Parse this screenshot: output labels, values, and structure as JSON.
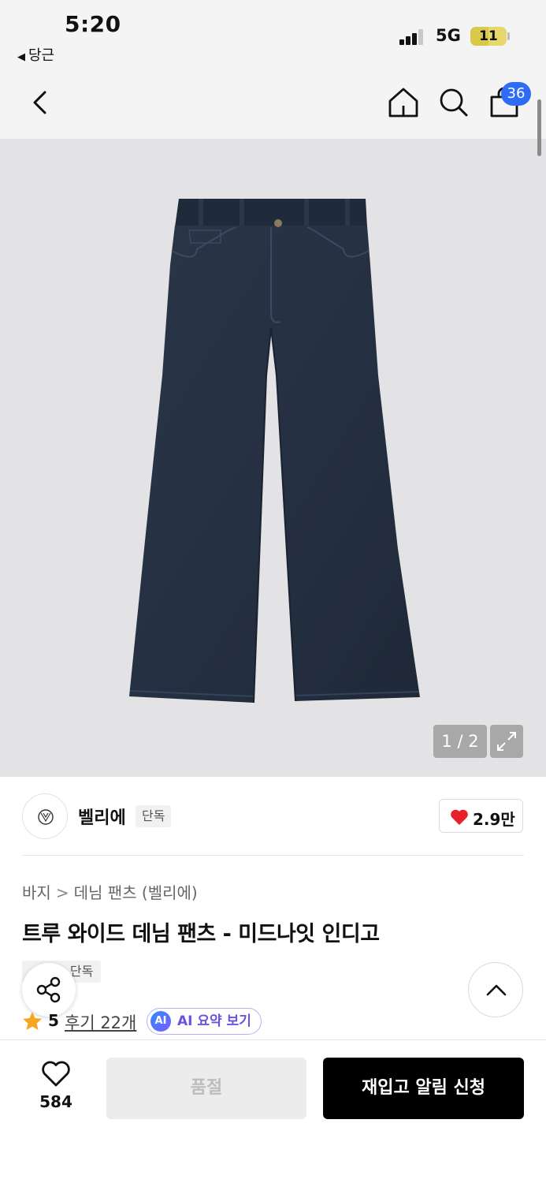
{
  "status_bar": {
    "time": "5:20",
    "back_app": "당근",
    "network": "5G",
    "battery": "11"
  },
  "nav": {
    "cart_count": "36",
    "icons": [
      "back-chevron-icon",
      "home-icon",
      "search-icon",
      "cart-bag-icon"
    ]
  },
  "gallery": {
    "counter": "1 / 2"
  },
  "brand": {
    "name": "벨리에",
    "tag": "단독",
    "likes": "2.9만"
  },
  "product": {
    "breadcrumb": [
      "바지",
      "데님 팬츠 (벨리에)"
    ],
    "title": "트루 와이드 데님 팬츠 - 미드나잇 인디고",
    "tag": "단독",
    "rating": "5",
    "reviews": "후기 22개",
    "ai_badge": "AI",
    "ai_summary": "AI 요약 보기"
  },
  "bottom": {
    "wish_count": "584",
    "soldout_label": "품절",
    "restock_label": "재입고 알림 신청"
  },
  "colors": {
    "accent_blue": "#2f6cf5",
    "heart_red": "#e8202a",
    "star_orange": "#f5a623",
    "ai_purple": "#6b52e0",
    "denim": "#263243"
  }
}
